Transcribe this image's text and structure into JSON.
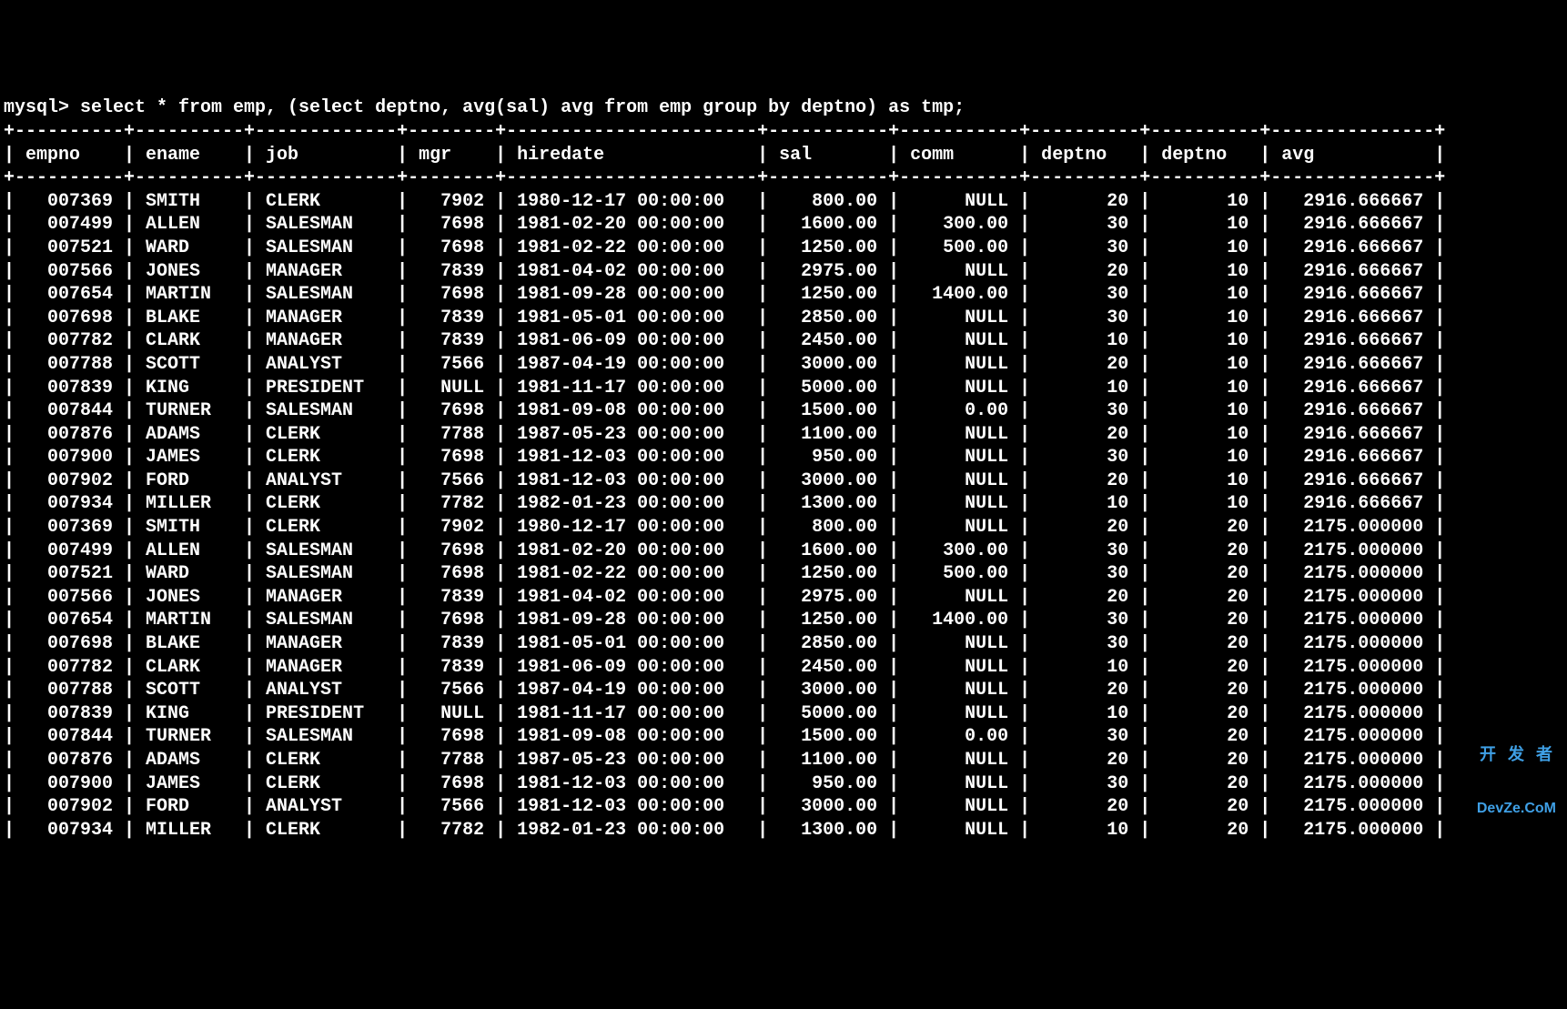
{
  "prompt": "mysql> ",
  "query": "select * from emp, (select deptno, avg(sal) avg from emp group by deptno) as tmp;",
  "watermark": {
    "line1": "开 发 者",
    "line2": "DevZe.CoM"
  },
  "columns": [
    "empno",
    "ename",
    "job",
    "mgr",
    "hiredate",
    "sal",
    "comm",
    "deptno",
    "deptno",
    "avg"
  ],
  "widths": [
    8,
    8,
    11,
    6,
    21,
    9,
    9,
    8,
    8,
    13
  ],
  "aligns": [
    "r",
    "l",
    "l",
    "r",
    "l",
    "r",
    "r",
    "r",
    "r",
    "r"
  ],
  "rows": [
    [
      "007369",
      "SMITH",
      "CLERK",
      "7902",
      "1980-12-17 00:00:00",
      "800.00",
      "NULL",
      "20",
      "10",
      "2916.666667"
    ],
    [
      "007499",
      "ALLEN",
      "SALESMAN",
      "7698",
      "1981-02-20 00:00:00",
      "1600.00",
      "300.00",
      "30",
      "10",
      "2916.666667"
    ],
    [
      "007521",
      "WARD",
      "SALESMAN",
      "7698",
      "1981-02-22 00:00:00",
      "1250.00",
      "500.00",
      "30",
      "10",
      "2916.666667"
    ],
    [
      "007566",
      "JONES",
      "MANAGER",
      "7839",
      "1981-04-02 00:00:00",
      "2975.00",
      "NULL",
      "20",
      "10",
      "2916.666667"
    ],
    [
      "007654",
      "MARTIN",
      "SALESMAN",
      "7698",
      "1981-09-28 00:00:00",
      "1250.00",
      "1400.00",
      "30",
      "10",
      "2916.666667"
    ],
    [
      "007698",
      "BLAKE",
      "MANAGER",
      "7839",
      "1981-05-01 00:00:00",
      "2850.00",
      "NULL",
      "30",
      "10",
      "2916.666667"
    ],
    [
      "007782",
      "CLARK",
      "MANAGER",
      "7839",
      "1981-06-09 00:00:00",
      "2450.00",
      "NULL",
      "10",
      "10",
      "2916.666667"
    ],
    [
      "007788",
      "SCOTT",
      "ANALYST",
      "7566",
      "1987-04-19 00:00:00",
      "3000.00",
      "NULL",
      "20",
      "10",
      "2916.666667"
    ],
    [
      "007839",
      "KING",
      "PRESIDENT",
      "NULL",
      "1981-11-17 00:00:00",
      "5000.00",
      "NULL",
      "10",
      "10",
      "2916.666667"
    ],
    [
      "007844",
      "TURNER",
      "SALESMAN",
      "7698",
      "1981-09-08 00:00:00",
      "1500.00",
      "0.00",
      "30",
      "10",
      "2916.666667"
    ],
    [
      "007876",
      "ADAMS",
      "CLERK",
      "7788",
      "1987-05-23 00:00:00",
      "1100.00",
      "NULL",
      "20",
      "10",
      "2916.666667"
    ],
    [
      "007900",
      "JAMES",
      "CLERK",
      "7698",
      "1981-12-03 00:00:00",
      "950.00",
      "NULL",
      "30",
      "10",
      "2916.666667"
    ],
    [
      "007902",
      "FORD",
      "ANALYST",
      "7566",
      "1981-12-03 00:00:00",
      "3000.00",
      "NULL",
      "20",
      "10",
      "2916.666667"
    ],
    [
      "007934",
      "MILLER",
      "CLERK",
      "7782",
      "1982-01-23 00:00:00",
      "1300.00",
      "NULL",
      "10",
      "10",
      "2916.666667"
    ],
    [
      "007369",
      "SMITH",
      "CLERK",
      "7902",
      "1980-12-17 00:00:00",
      "800.00",
      "NULL",
      "20",
      "20",
      "2175.000000"
    ],
    [
      "007499",
      "ALLEN",
      "SALESMAN",
      "7698",
      "1981-02-20 00:00:00",
      "1600.00",
      "300.00",
      "30",
      "20",
      "2175.000000"
    ],
    [
      "007521",
      "WARD",
      "SALESMAN",
      "7698",
      "1981-02-22 00:00:00",
      "1250.00",
      "500.00",
      "30",
      "20",
      "2175.000000"
    ],
    [
      "007566",
      "JONES",
      "MANAGER",
      "7839",
      "1981-04-02 00:00:00",
      "2975.00",
      "NULL",
      "20",
      "20",
      "2175.000000"
    ],
    [
      "007654",
      "MARTIN",
      "SALESMAN",
      "7698",
      "1981-09-28 00:00:00",
      "1250.00",
      "1400.00",
      "30",
      "20",
      "2175.000000"
    ],
    [
      "007698",
      "BLAKE",
      "MANAGER",
      "7839",
      "1981-05-01 00:00:00",
      "2850.00",
      "NULL",
      "30",
      "20",
      "2175.000000"
    ],
    [
      "007782",
      "CLARK",
      "MANAGER",
      "7839",
      "1981-06-09 00:00:00",
      "2450.00",
      "NULL",
      "10",
      "20",
      "2175.000000"
    ],
    [
      "007788",
      "SCOTT",
      "ANALYST",
      "7566",
      "1987-04-19 00:00:00",
      "3000.00",
      "NULL",
      "20",
      "20",
      "2175.000000"
    ],
    [
      "007839",
      "KING",
      "PRESIDENT",
      "NULL",
      "1981-11-17 00:00:00",
      "5000.00",
      "NULL",
      "10",
      "20",
      "2175.000000"
    ],
    [
      "007844",
      "TURNER",
      "SALESMAN",
      "7698",
      "1981-09-08 00:00:00",
      "1500.00",
      "0.00",
      "30",
      "20",
      "2175.000000"
    ],
    [
      "007876",
      "ADAMS",
      "CLERK",
      "7788",
      "1987-05-23 00:00:00",
      "1100.00",
      "NULL",
      "20",
      "20",
      "2175.000000"
    ],
    [
      "007900",
      "JAMES",
      "CLERK",
      "7698",
      "1981-12-03 00:00:00",
      "950.00",
      "NULL",
      "30",
      "20",
      "2175.000000"
    ],
    [
      "007902",
      "FORD",
      "ANALYST",
      "7566",
      "1981-12-03 00:00:00",
      "3000.00",
      "NULL",
      "20",
      "20",
      "2175.000000"
    ],
    [
      "007934",
      "MILLER",
      "CLERK",
      "7782",
      "1982-01-23 00:00:00",
      "1300.00",
      "NULL",
      "10",
      "20",
      "2175.000000"
    ]
  ]
}
